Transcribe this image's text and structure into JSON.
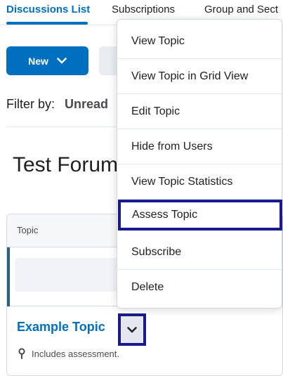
{
  "tabs": [
    {
      "label": "Discussions List"
    },
    {
      "label": "Subscriptions"
    },
    {
      "label": "Group and Sect"
    }
  ],
  "toolbar": {
    "new_label": "New",
    "filter_label": "Filter by:",
    "filter_value": "Unread"
  },
  "forum": {
    "title": "Test Forum"
  },
  "card": {
    "header": "Topic",
    "topic_title": "Example Topic",
    "assessment_note": "Includes assessment."
  },
  "menu": {
    "items": [
      {
        "label": "View Topic"
      },
      {
        "label": "View Topic in Grid View"
      },
      {
        "label": "Edit Topic"
      },
      {
        "label": "Hide from Users"
      },
      {
        "label": "View Topic Statistics"
      },
      {
        "label": "Assess Topic"
      },
      {
        "label": "Subscribe"
      },
      {
        "label": "Delete"
      }
    ]
  },
  "colors": {
    "accent": "#006fbf",
    "highlight_border": "#1a1a8c"
  },
  "icons": {
    "new_chevron": "chevron-down-icon",
    "topic_chevron": "chevron-down-icon",
    "assessment": "pin-icon"
  }
}
